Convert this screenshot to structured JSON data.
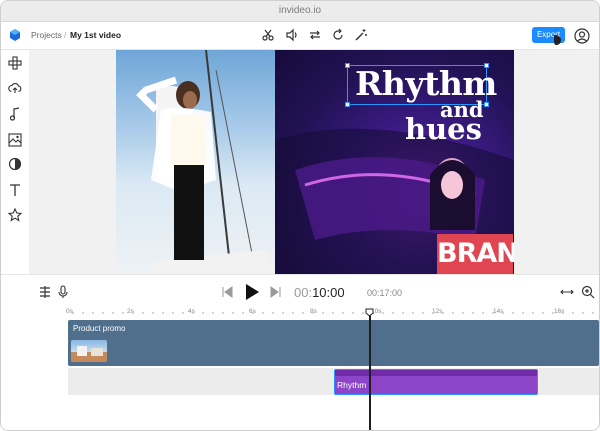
{
  "browser": {
    "url": "invideo.io"
  },
  "header": {
    "breadcrumb_root": "Projects",
    "breadcrumb_separator": "/",
    "project_name": "My 1st video",
    "export_label": "Export",
    "tools": [
      "scissors-icon",
      "volume-icon",
      "swap-icon",
      "rotate-icon",
      "magic-wand-icon"
    ]
  },
  "sidebar": {
    "items": [
      "layout-icon",
      "upload-icon",
      "music-icon",
      "media-icon",
      "color-icon",
      "text-icon",
      "star-icon"
    ]
  },
  "canvas": {
    "headline": "Rhythm",
    "subline_1": "and",
    "subline_2": "hues",
    "brand_text": "BRAND"
  },
  "player": {
    "time_current_prefix": "00:",
    "time_current": "10:00",
    "time_total": "00:17:00"
  },
  "timeline": {
    "ruler_labels": [
      "0s",
      "2s",
      "4s",
      "6s",
      "8s",
      "10s",
      "12s",
      "14s",
      "16s"
    ],
    "video_track_label": "Product promo",
    "audio_clip_label": "Rhythm"
  },
  "colors": {
    "accent": "#1a8cff",
    "video_track": "#4f6f8c",
    "audio_clip": "#8c45c7",
    "brand_badge": "#e04552"
  }
}
